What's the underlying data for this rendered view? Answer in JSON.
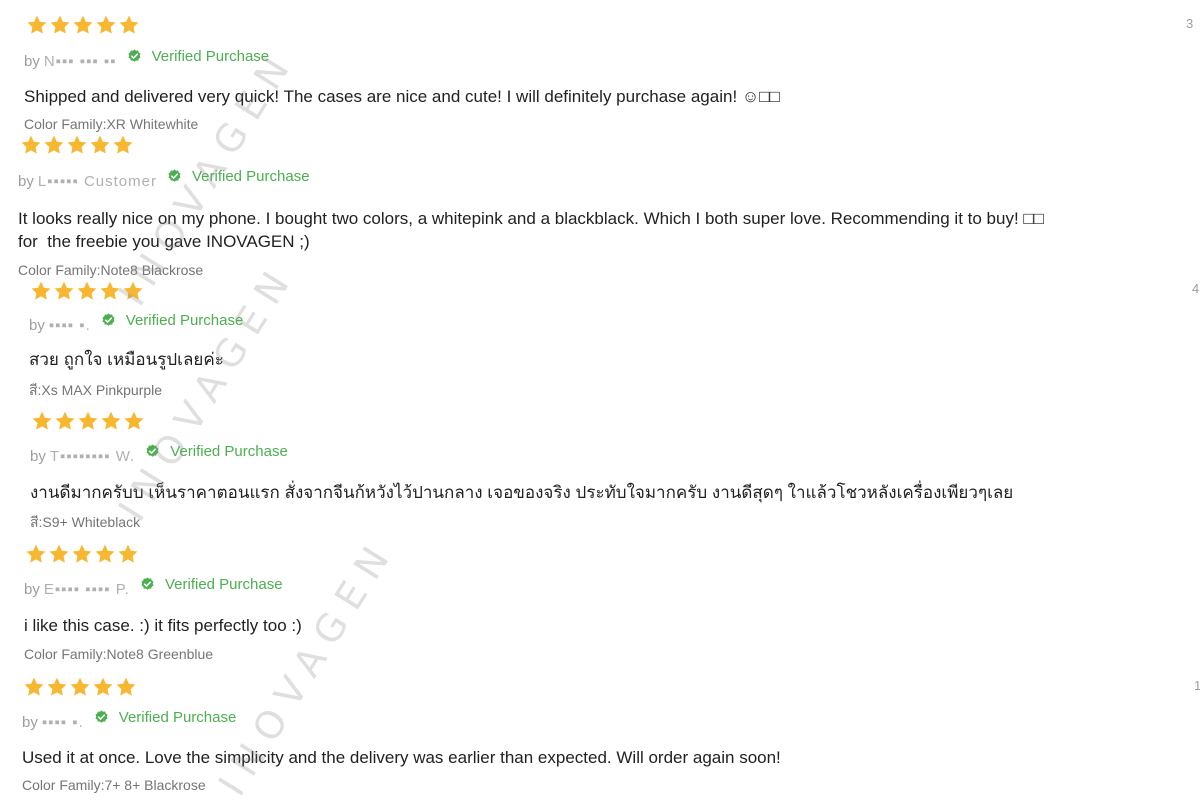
{
  "colors": {
    "star": "#f7b731",
    "verified": "#4caf50",
    "muted": "#757575",
    "text": "#212121"
  },
  "watermark_text": "INOVAGEN",
  "side_numbers": [
    "3",
    "4",
    "1"
  ],
  "reviews": [
    {
      "rating": 5,
      "by": "by",
      "author": "N▪▪▪ ▪▪▪ ▪▪",
      "verified_label": "Verified Purchase",
      "content": "Shipped and delivered very quick! The cases are nice and cute! I will definitely purchase again! ☺□□",
      "sku": "Color Family:XR Whitewhite"
    },
    {
      "rating": 5,
      "by": "by",
      "author": "L▪▪▪▪▪ Customer",
      "verified_label": "Verified Purchase",
      "content": "It looks really nice on my phone. I bought two colors, a whitepink and a blackblack. Which I both super love. Recommending it to buy! □□\nfor  the freebie you gave INOVAGEN ;)",
      "sku": "Color Family:Note8 Blackrose"
    },
    {
      "rating": 5,
      "by": "by",
      "author": "▪▪▪▪ ▪.",
      "verified_label": "Verified Purchase",
      "content": "สวย ถูกใจ เหมือนรูปเลยค่ะ",
      "sku": "สี:Xs MAX Pinkpurple"
    },
    {
      "rating": 5,
      "by": "by",
      "author": "T▪▪▪▪▪▪▪▪ W.",
      "verified_label": "Verified Purchase",
      "content": "งานดีมากครับบ เห็นราคาตอนแรก สั่งจากจีนก้หวังไว้ปานกลาง เจอของจริง ประทับใจมากครับ งานดีสุดๆ ใาแล้วโชวหลังเครื่องเพียวๆเลย",
      "sku": "สี:S9+ Whiteblack"
    },
    {
      "rating": 5,
      "by": "by",
      "author": "E▪▪▪▪ ▪▪▪▪ P.",
      "verified_label": "Verified Purchase",
      "content": "i like this case. :) it fits perfectly too :)",
      "sku": "Color Family:Note8 Greenblue"
    },
    {
      "rating": 5,
      "by": "by",
      "author": "▪▪▪▪ ▪.",
      "verified_label": "Verified Purchase",
      "content": "Used it at once. Love the simplicity and the delivery was earlier than expected. Will order again soon!",
      "sku": "Color Family:7+ 8+ Blackrose"
    }
  ]
}
